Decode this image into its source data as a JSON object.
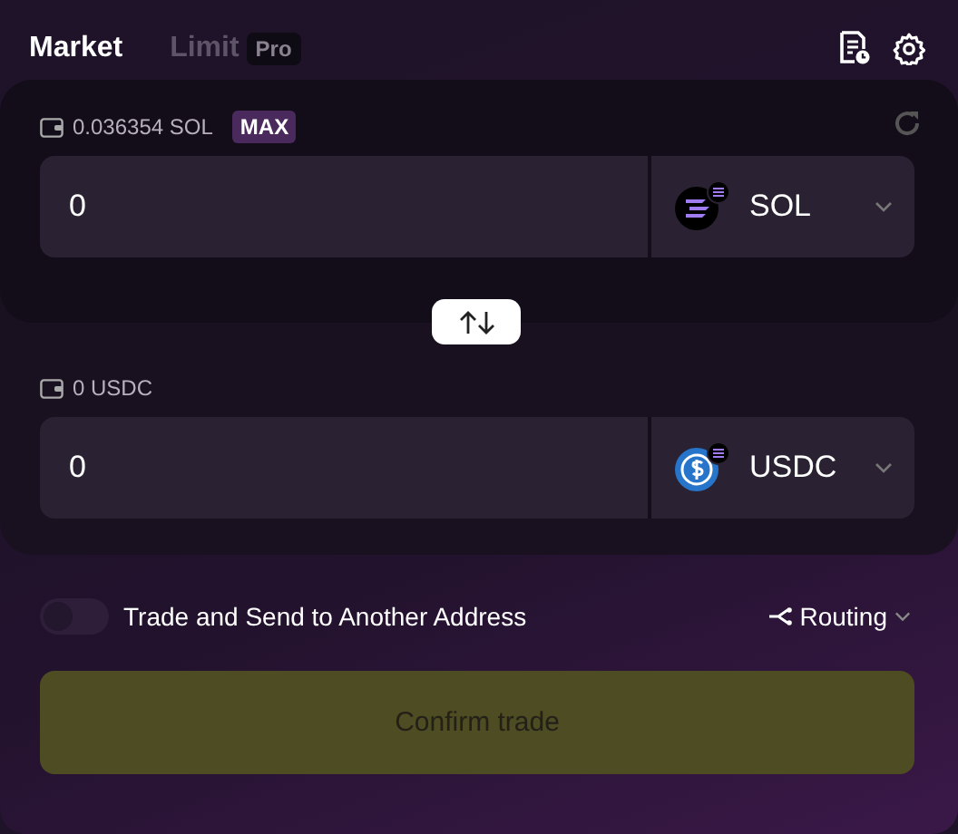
{
  "tabs": [
    {
      "label": "Market",
      "selected": true
    },
    {
      "label": "Limit",
      "selected": false,
      "badge": "Pro"
    }
  ],
  "swap": [
    {
      "balance": "0.036354 SOL",
      "max": "MAX",
      "amount": "0",
      "token": "SOL",
      "kind": "sol"
    },
    {
      "balance": "0 USDC",
      "amount": "0",
      "token": "USDC",
      "kind": "usdc"
    }
  ],
  "send_toggle": {
    "label": "Trade and Send to Another Address",
    "on": false
  },
  "routing": "Routing",
  "confirm": {
    "label": "Confirm trade",
    "disabled": true
  }
}
